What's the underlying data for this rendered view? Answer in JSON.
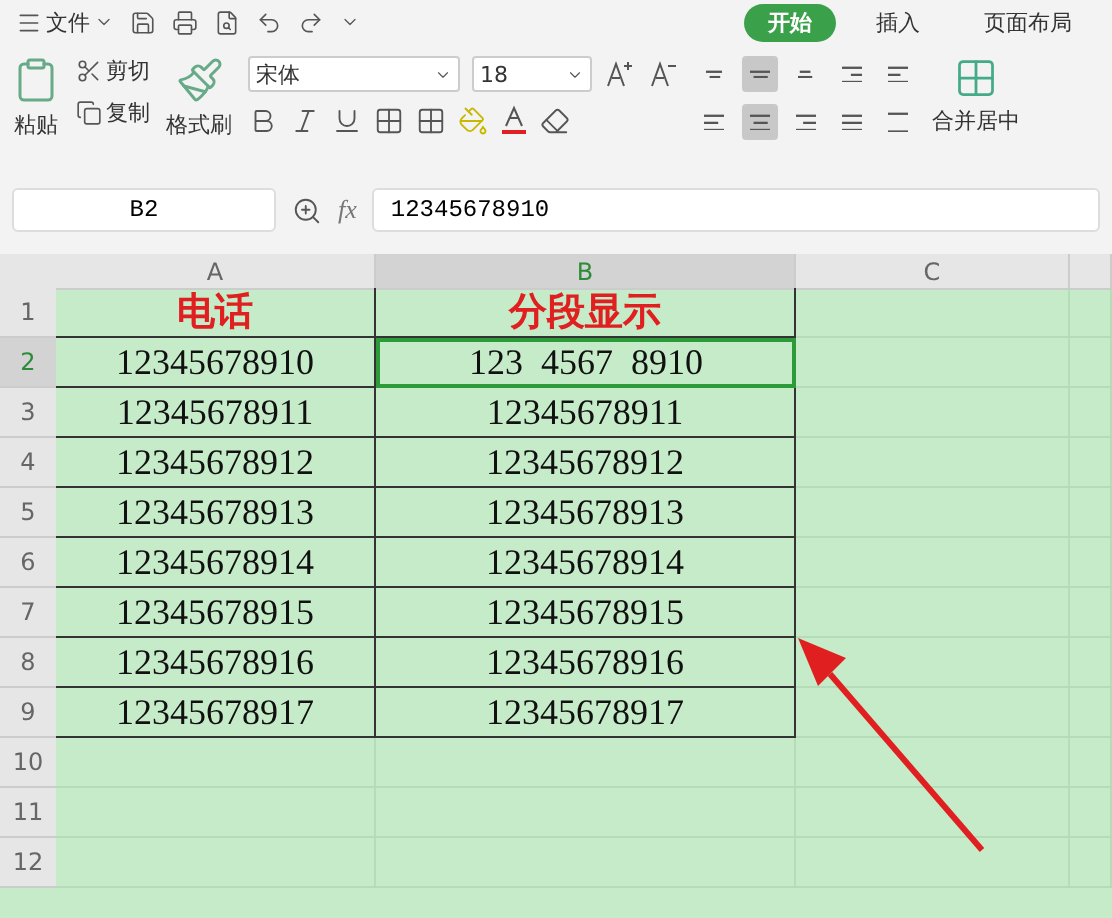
{
  "menu": {
    "label": "文件"
  },
  "tabs": [
    {
      "label": "开始",
      "selected": true
    },
    {
      "label": "插入",
      "selected": false
    },
    {
      "label": "页面布局",
      "selected": false
    }
  ],
  "clipboard": {
    "paste": "粘贴",
    "cut": "剪切",
    "copy": "复制",
    "format_painter": "格式刷"
  },
  "font": {
    "name": "宋体",
    "size": "18"
  },
  "alignment": [
    {
      "kind": "top",
      "selected": false
    },
    {
      "kind": "middle",
      "selected": true
    },
    {
      "kind": "bottom",
      "selected": false
    },
    {
      "kind": "outdent",
      "selected": false
    },
    {
      "kind": "indent",
      "selected": false
    },
    {
      "kind": "left",
      "selected": false
    },
    {
      "kind": "center",
      "selected": true
    },
    {
      "kind": "right",
      "selected": false
    },
    {
      "kind": "justify",
      "selected": false
    },
    {
      "kind": "distribute",
      "selected": false
    }
  ],
  "merge": {
    "label": "合并居中"
  },
  "name_box": "B2",
  "fx": "fx",
  "formula": "12345678910",
  "columns": [
    {
      "label": "A",
      "selected": false
    },
    {
      "label": "B",
      "selected": true
    },
    {
      "label": "C",
      "selected": false
    }
  ],
  "rows": [
    {
      "number": "1",
      "kind": "header",
      "selected": false,
      "cells": [
        "电话",
        "分段显示"
      ]
    },
    {
      "number": "2",
      "kind": "data",
      "selected": true,
      "cells": [
        "12345678910",
        "123  4567  8910"
      ]
    },
    {
      "number": "3",
      "kind": "data",
      "selected": false,
      "cells": [
        "12345678911",
        "12345678911"
      ]
    },
    {
      "number": "4",
      "kind": "data",
      "selected": false,
      "cells": [
        "12345678912",
        "12345678912"
      ]
    },
    {
      "number": "5",
      "kind": "data",
      "selected": false,
      "cells": [
        "12345678913",
        "12345678913"
      ]
    },
    {
      "number": "6",
      "kind": "data",
      "selected": false,
      "cells": [
        "12345678914",
        "12345678914"
      ]
    },
    {
      "number": "7",
      "kind": "data",
      "selected": false,
      "cells": [
        "12345678915",
        "12345678915"
      ]
    },
    {
      "number": "8",
      "kind": "data",
      "selected": false,
      "cells": [
        "12345678916",
        "12345678916"
      ]
    },
    {
      "number": "9",
      "kind": "data",
      "selected": false,
      "cells": [
        "12345678917",
        "12345678917"
      ]
    },
    {
      "number": "10",
      "selected": false,
      "cells": []
    },
    {
      "number": "11",
      "selected": false,
      "cells": []
    },
    {
      "number": "12",
      "selected": false,
      "cells": []
    }
  ]
}
